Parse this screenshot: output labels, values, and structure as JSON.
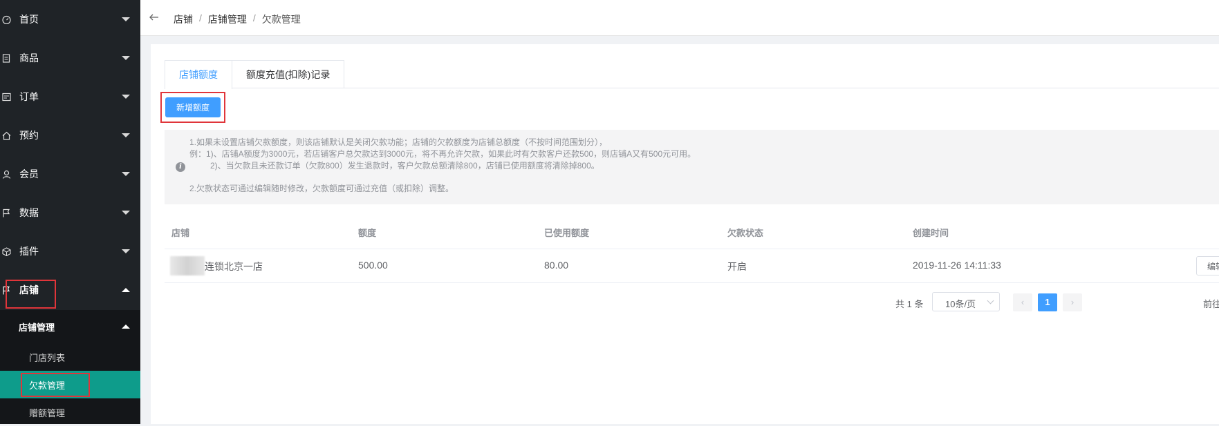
{
  "sidebar": {
    "items": [
      {
        "label": "首页",
        "icon": "dashboard-icon"
      },
      {
        "label": "商品",
        "icon": "document-icon"
      },
      {
        "label": "订单",
        "icon": "order-icon"
      },
      {
        "label": "预约",
        "icon": "home-icon"
      },
      {
        "label": "会员",
        "icon": "user-icon"
      },
      {
        "label": "数据",
        "icon": "flag-icon"
      },
      {
        "label": "插件",
        "icon": "cube-icon"
      },
      {
        "label": "店铺",
        "icon": "flag-icon"
      }
    ],
    "submenu": {
      "title": "店铺管理",
      "items": [
        {
          "label": "门店列表"
        },
        {
          "label": "欠款管理"
        },
        {
          "label": "赠额管理"
        }
      ]
    },
    "colors": {
      "bg": "#1f2327",
      "active": "#0e9c8b",
      "highlight_box": "#e0353a"
    }
  },
  "header": {
    "breadcrumb": [
      "店铺",
      "店铺管理",
      "欠款管理"
    ],
    "separator": "/"
  },
  "tabs": [
    {
      "label": "店铺额度",
      "active": true
    },
    {
      "label": "额度充值(扣除)记录",
      "active": false
    }
  ],
  "toolbar": {
    "add_label": "新增额度"
  },
  "notice": {
    "lines": [
      "1.如果未设置店铺欠款额度，则该店铺默认是关闭欠款功能；店铺的欠款额度为店铺总额度（不按时间范围划分），",
      "例：1)、店铺A额度为3000元，若店铺客户总欠款达到3000元，将不再允许欠款，如果此时有欠款客户还款500，则店铺A又有500元可用。",
      "2)、当欠款且未还款订单（欠款800）发生退款时，客户欠款总额清除800，店铺已使用额度将清除掉800。",
      "2.欠款状态可通过编辑随时修改，欠款额度可通过充值（或扣除）调整。"
    ]
  },
  "table": {
    "headers": [
      "店铺",
      "额度",
      "已使用额度",
      "欠款状态",
      "创建时间"
    ],
    "rows": [
      {
        "shop": "连锁北京一店",
        "quota": "500.00",
        "used": "80.00",
        "status": "开启",
        "created": "2019-11-26 14:11:33",
        "action": "编辑"
      }
    ]
  },
  "pagination": {
    "total": "共 1 条",
    "page_size": "10条/页",
    "current_page": "1",
    "prev": "‹",
    "next": "›",
    "goto": "前往"
  },
  "accent": "#409eff"
}
